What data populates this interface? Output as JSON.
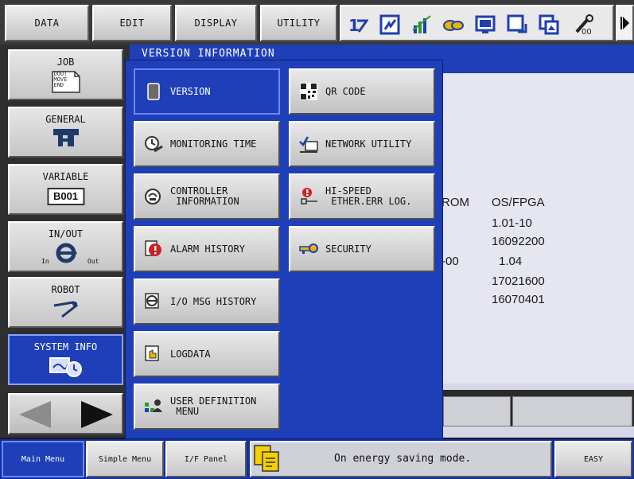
{
  "topmenu": {
    "data": "DATA",
    "edit": "EDIT",
    "display": "DISPLAY",
    "utility": "UTILITY",
    "icons": [
      "num-keys-icon",
      "checkbox-icon",
      "chart-icon",
      "handshake-icon",
      "display-icon",
      "window-icon",
      "image-icon",
      "tool-icon"
    ]
  },
  "left": {
    "job": "JOB",
    "job_icon_text": [
      "DOUT",
      "MOVE",
      "END"
    ],
    "general": "GENERAL",
    "variable": "VARIABLE",
    "variable_badge": "B001",
    "inout": "IN/OUT",
    "in": "In",
    "out": "Out",
    "robot": "ROBOT",
    "system_info": "SYSTEM INFO"
  },
  "main": {
    "title": "VERSION INFORMATION",
    "info_rows": {
      "rom": "ROM",
      "osfpga": "OS/FPGA",
      "v1": "1.01-10",
      "v2": "16092200",
      "dash00": "-00",
      "v3": "1.04",
      "v4": "17021600",
      "v5": "16070401"
    }
  },
  "popup": {
    "version": "VERSION",
    "monitoring_time": "MONITORING TIME",
    "controller_info": "CONTROLLER\n INFORMATION",
    "alarm_history": "ALARM HISTORY",
    "io_msg_history": "I/O MSG HISTORY",
    "logdata": "LOGDATA",
    "user_def_menu": "USER DEFINITION\n MENU",
    "qr_code": "QR CODE",
    "network_utility": "NETWORK UTILITY",
    "hispeed": "HI-SPEED\n ETHER.ERR LOG.",
    "security": "SECURITY"
  },
  "status": {
    "main_menu": "Main Menu",
    "simple_menu": "Simple Menu",
    "if_panel": "I/F Panel",
    "message": "On energy saving mode.",
    "easy": "EASY"
  },
  "colors": {
    "accent": "#1f3fb8",
    "panel": "#d7d8e7"
  }
}
